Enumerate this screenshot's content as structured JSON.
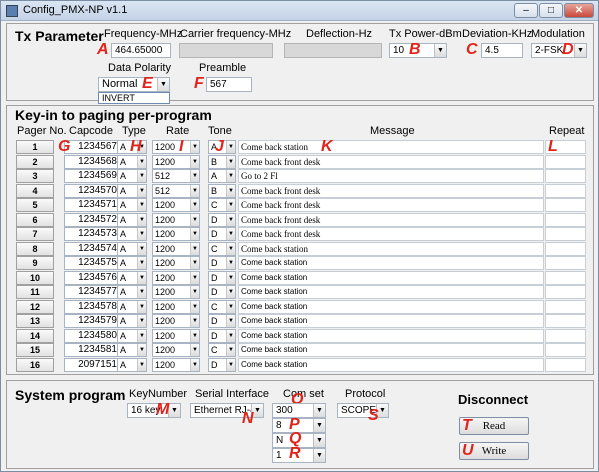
{
  "window": {
    "title": "Config_PMX-NP v1.1",
    "min": "–",
    "max": "□",
    "close": "✕"
  },
  "tx": {
    "section_title": "Tx Parameter",
    "frequency_label": "Frequency-MHz",
    "frequency_value": "464.65000",
    "carrier_label": "Carrier frequency-MHz",
    "deflection_label": "Deflection-Hz",
    "txpower_label": "Tx Power-dBm",
    "txpower_value": "10",
    "deviation_label": "Deviation-KHz",
    "deviation_value": "4.5",
    "modulation_label": "Modulation",
    "modulation_value": "2-FSK",
    "polarity_label": "Data Polarity",
    "polarity_value": "Normal",
    "polarity_option_open": "INVERT",
    "preamble_label": "Preamble",
    "preamble_value": "567"
  },
  "markers": {
    "A": "A",
    "B": "B",
    "C": "C",
    "D": "D",
    "E": "E",
    "F": "F",
    "G": "G",
    "H": "H",
    "I": "I",
    "J": "J",
    "K": "K",
    "L": "L",
    "M": "M",
    "N": "N",
    "O": "O",
    "P": "P",
    "Q": "Q",
    "R": "R",
    "S": "S",
    "T": "T",
    "U": "U"
  },
  "paging": {
    "section_title": "Key-in to paging per-program",
    "headers": {
      "pager_no": "Pager No.",
      "capcode": "Capcode",
      "type": "Type",
      "rate": "Rate",
      "tone": "Tone",
      "message": "Message",
      "repeat": "Repeat"
    },
    "rows": [
      {
        "no": "1",
        "capcode": "1234567",
        "type": "A",
        "rate": "1200",
        "tone": "A",
        "message": "Come back station",
        "sans": false
      },
      {
        "no": "2",
        "capcode": "1234568",
        "type": "A",
        "rate": "1200",
        "tone": "B",
        "message": "Come back front desk",
        "sans": false
      },
      {
        "no": "3",
        "capcode": "1234569",
        "type": "A",
        "rate": "512",
        "tone": "A",
        "message": "Go to 2 Fl",
        "sans": false
      },
      {
        "no": "4",
        "capcode": "1234570",
        "type": "A",
        "rate": "512",
        "tone": "B",
        "message": "Come back front desk",
        "sans": false
      },
      {
        "no": "5",
        "capcode": "1234571",
        "type": "A",
        "rate": "1200",
        "tone": "C",
        "message": "Come back front desk",
        "sans": false
      },
      {
        "no": "6",
        "capcode": "1234572",
        "type": "A",
        "rate": "1200",
        "tone": "D",
        "message": "Come back front desk",
        "sans": false
      },
      {
        "no": "7",
        "capcode": "1234573",
        "type": "A",
        "rate": "1200",
        "tone": "D",
        "message": "Come back front desk",
        "sans": false
      },
      {
        "no": "8",
        "capcode": "1234574",
        "type": "A",
        "rate": "1200",
        "tone": "C",
        "message": "Come back station",
        "sans": false
      },
      {
        "no": "9",
        "capcode": "1234575",
        "type": "A",
        "rate": "1200",
        "tone": "D",
        "message": "Come back station",
        "sans": true
      },
      {
        "no": "10",
        "capcode": "1234576",
        "type": "A",
        "rate": "1200",
        "tone": "D",
        "message": "Come back station",
        "sans": true
      },
      {
        "no": "11",
        "capcode": "1234577",
        "type": "A",
        "rate": "1200",
        "tone": "D",
        "message": "Come back station",
        "sans": true
      },
      {
        "no": "12",
        "capcode": "1234578",
        "type": "A",
        "rate": "1200",
        "tone": "C",
        "message": "Come back station",
        "sans": true
      },
      {
        "no": "13",
        "capcode": "1234579",
        "type": "A",
        "rate": "1200",
        "tone": "D",
        "message": "Come back station",
        "sans": true
      },
      {
        "no": "14",
        "capcode": "1234580",
        "type": "A",
        "rate": "1200",
        "tone": "D",
        "message": "Come back station",
        "sans": true
      },
      {
        "no": "15",
        "capcode": "1234581",
        "type": "A",
        "rate": "1200",
        "tone": "C",
        "message": "Come back station",
        "sans": true
      },
      {
        "no": "16",
        "capcode": "2097151",
        "type": "A",
        "rate": "1200",
        "tone": "D",
        "message": "Come back station",
        "sans": true
      }
    ]
  },
  "system": {
    "section_title": "System program",
    "keynumber_label": "KeyNumber",
    "keynumber_value": "16 key",
    "serial_label": "Serial Interface",
    "serial_value": "Ethernet RJ-45",
    "comset_label": "Com set",
    "comset_baud": "300",
    "comset_bits": "8",
    "comset_parity": "N",
    "comset_stop": "1",
    "protocol_label": "Protocol",
    "protocol_value": "SCOPE",
    "disconnect_label": "Disconnect",
    "read_label": "Read",
    "write_label": "Write"
  }
}
